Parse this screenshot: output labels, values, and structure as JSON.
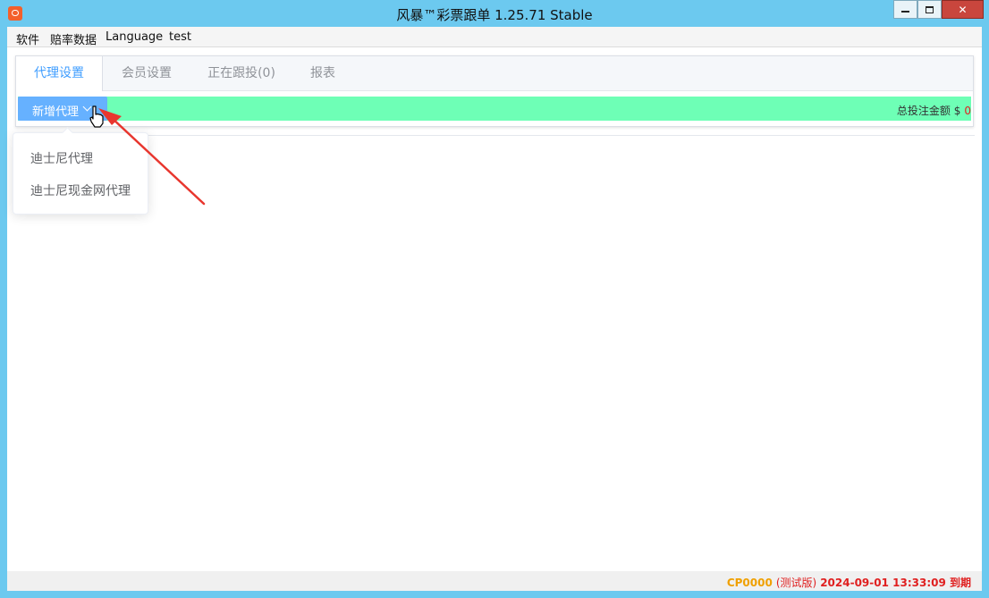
{
  "window": {
    "title": "风暴™彩票跟单 1.25.71 Stable",
    "controls": {
      "close": "✕"
    }
  },
  "menu": [
    "软件",
    "赔率数据",
    "Language",
    "test"
  ],
  "tabs": [
    "代理设置",
    "会员设置",
    "正在跟投(0)",
    "报表"
  ],
  "active_tab": 0,
  "toolbar": {
    "add_button_label": "新增代理",
    "total_label": "总投注金额 $",
    "total_value": "0"
  },
  "dropdown_items": [
    "迪士尼代理",
    "迪士尼现金网代理"
  ],
  "status": {
    "code": "CP0000",
    "edition": "(测试版)",
    "expiry": "2024-09-01 13:33:09 到期"
  },
  "colors": {
    "titlebar_bg": "#6cc9ef",
    "toolbar_bg": "#6effb6",
    "button_bg": "#66b1ff",
    "active_tab": "#409eff",
    "arrow": "#e8362e"
  }
}
